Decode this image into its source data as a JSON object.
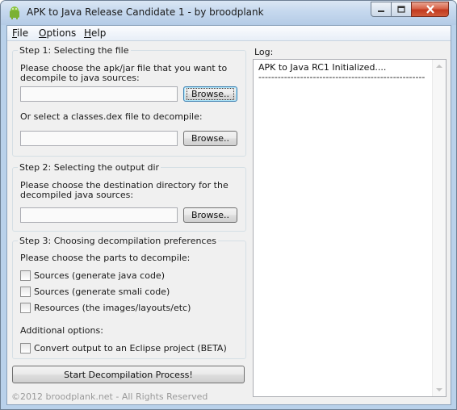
{
  "window": {
    "title": "APK to Java Release Candidate 1  -  by broodplank"
  },
  "menu": {
    "file": {
      "accel": "F",
      "rest": "ile"
    },
    "options": {
      "accel": "O",
      "rest": "ptions"
    },
    "help": {
      "accel": "H",
      "rest": "elp"
    }
  },
  "step1": {
    "title": "Step 1: Selecting the file",
    "instruction_line1": "Please choose the apk/jar file that you want to",
    "instruction_line2": "decompile to java sources:",
    "apk_path_value": "",
    "browse_label": "Browse..",
    "dex_instruction": "Or select a classes.dex file to decompile:",
    "dex_path_value": "",
    "dex_browse_label": "Browse.."
  },
  "step2": {
    "title": "Step 2: Selecting the output dir",
    "instruction_line1": "Please choose the destination directory for the",
    "instruction_line2": "decompiled java sources:",
    "output_path_value": "",
    "browse_label": "Browse.."
  },
  "step3": {
    "title": "Step 3: Choosing decompilation preferences",
    "instruction": "Please choose the parts to decompile:",
    "options": [
      {
        "label": "Sources (generate java code)",
        "checked": false
      },
      {
        "label": "Sources (generate smali code)",
        "checked": false
      },
      {
        "label": "Resources (the images/layouts/etc)",
        "checked": false
      }
    ],
    "additional_label": "Additional options:",
    "eclipse_option": {
      "label": "Convert output to an Eclipse project (BETA)",
      "checked": false
    }
  },
  "actions": {
    "start_label": "Start Decompilation Process!"
  },
  "log": {
    "label": "Log:",
    "lines": [
      "APK to Java RC1 Initialized....",
      "----------------------------------------------------"
    ]
  },
  "footer": {
    "copyright": "©2012 broodplank.net - All Rights Reserved"
  },
  "colors": {
    "titlebar": "#c5d8ee",
    "close_button": "#c2391f",
    "client_bg": "#f0f0f0",
    "focus_border": "#3c7fb1"
  }
}
